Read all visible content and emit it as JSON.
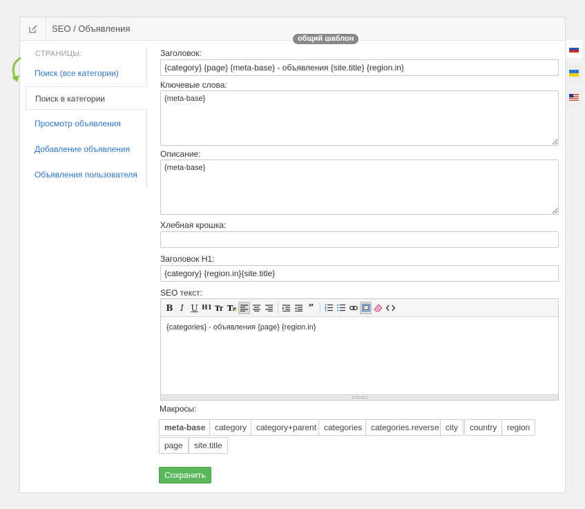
{
  "header": {
    "title": "SEO / Объявления",
    "icon": "edit-icon"
  },
  "template_badge": "общий шаблон",
  "sidebar": {
    "title": "СТРАНИЦЫ:",
    "items": [
      {
        "label": "Поиск (все категории)",
        "active": false
      },
      {
        "label": "Поиск в категории",
        "active": true
      },
      {
        "label": "Просмотр объявления",
        "active": false
      },
      {
        "label": "Добавление объявления",
        "active": false
      },
      {
        "label": "Объявления пользователя",
        "active": false
      }
    ]
  },
  "languages": [
    "flag-ru-icon",
    "flag-ua-icon",
    "flag-us-icon"
  ],
  "form": {
    "title_label": "Заголовок:",
    "title_value": "{category} {page} {meta-base} - объявления {site.title} {region.in}",
    "keywords_label": "Ключевые слова:",
    "keywords_value": "{meta-base}",
    "description_label": "Описание:",
    "description_value": "{meta-base}",
    "breadcrumb_label": "Хлебная крошка:",
    "breadcrumb_value": "",
    "h1_label": "Заголовок H1:",
    "h1_value": "{category} {region.in}{site.title}",
    "seo_text_label": "SEO текст:",
    "seo_text_value": "{categories} - объявления {page} {region.in}"
  },
  "toolbar": {
    "bold": "B",
    "italic": "I",
    "underline": "U",
    "heading": "H1",
    "font": "T",
    "quote": "“"
  },
  "macros": {
    "label": "Макросы:",
    "items": [
      "meta-base",
      "category",
      "category+parent",
      "categories",
      "categories.reverse",
      "city",
      "country",
      "region",
      "page",
      "site.title"
    ]
  },
  "save_label": "Сохранить",
  "colors": {
    "link": "#2e74c7",
    "save": "#5cb85c",
    "badge": "#888888"
  }
}
